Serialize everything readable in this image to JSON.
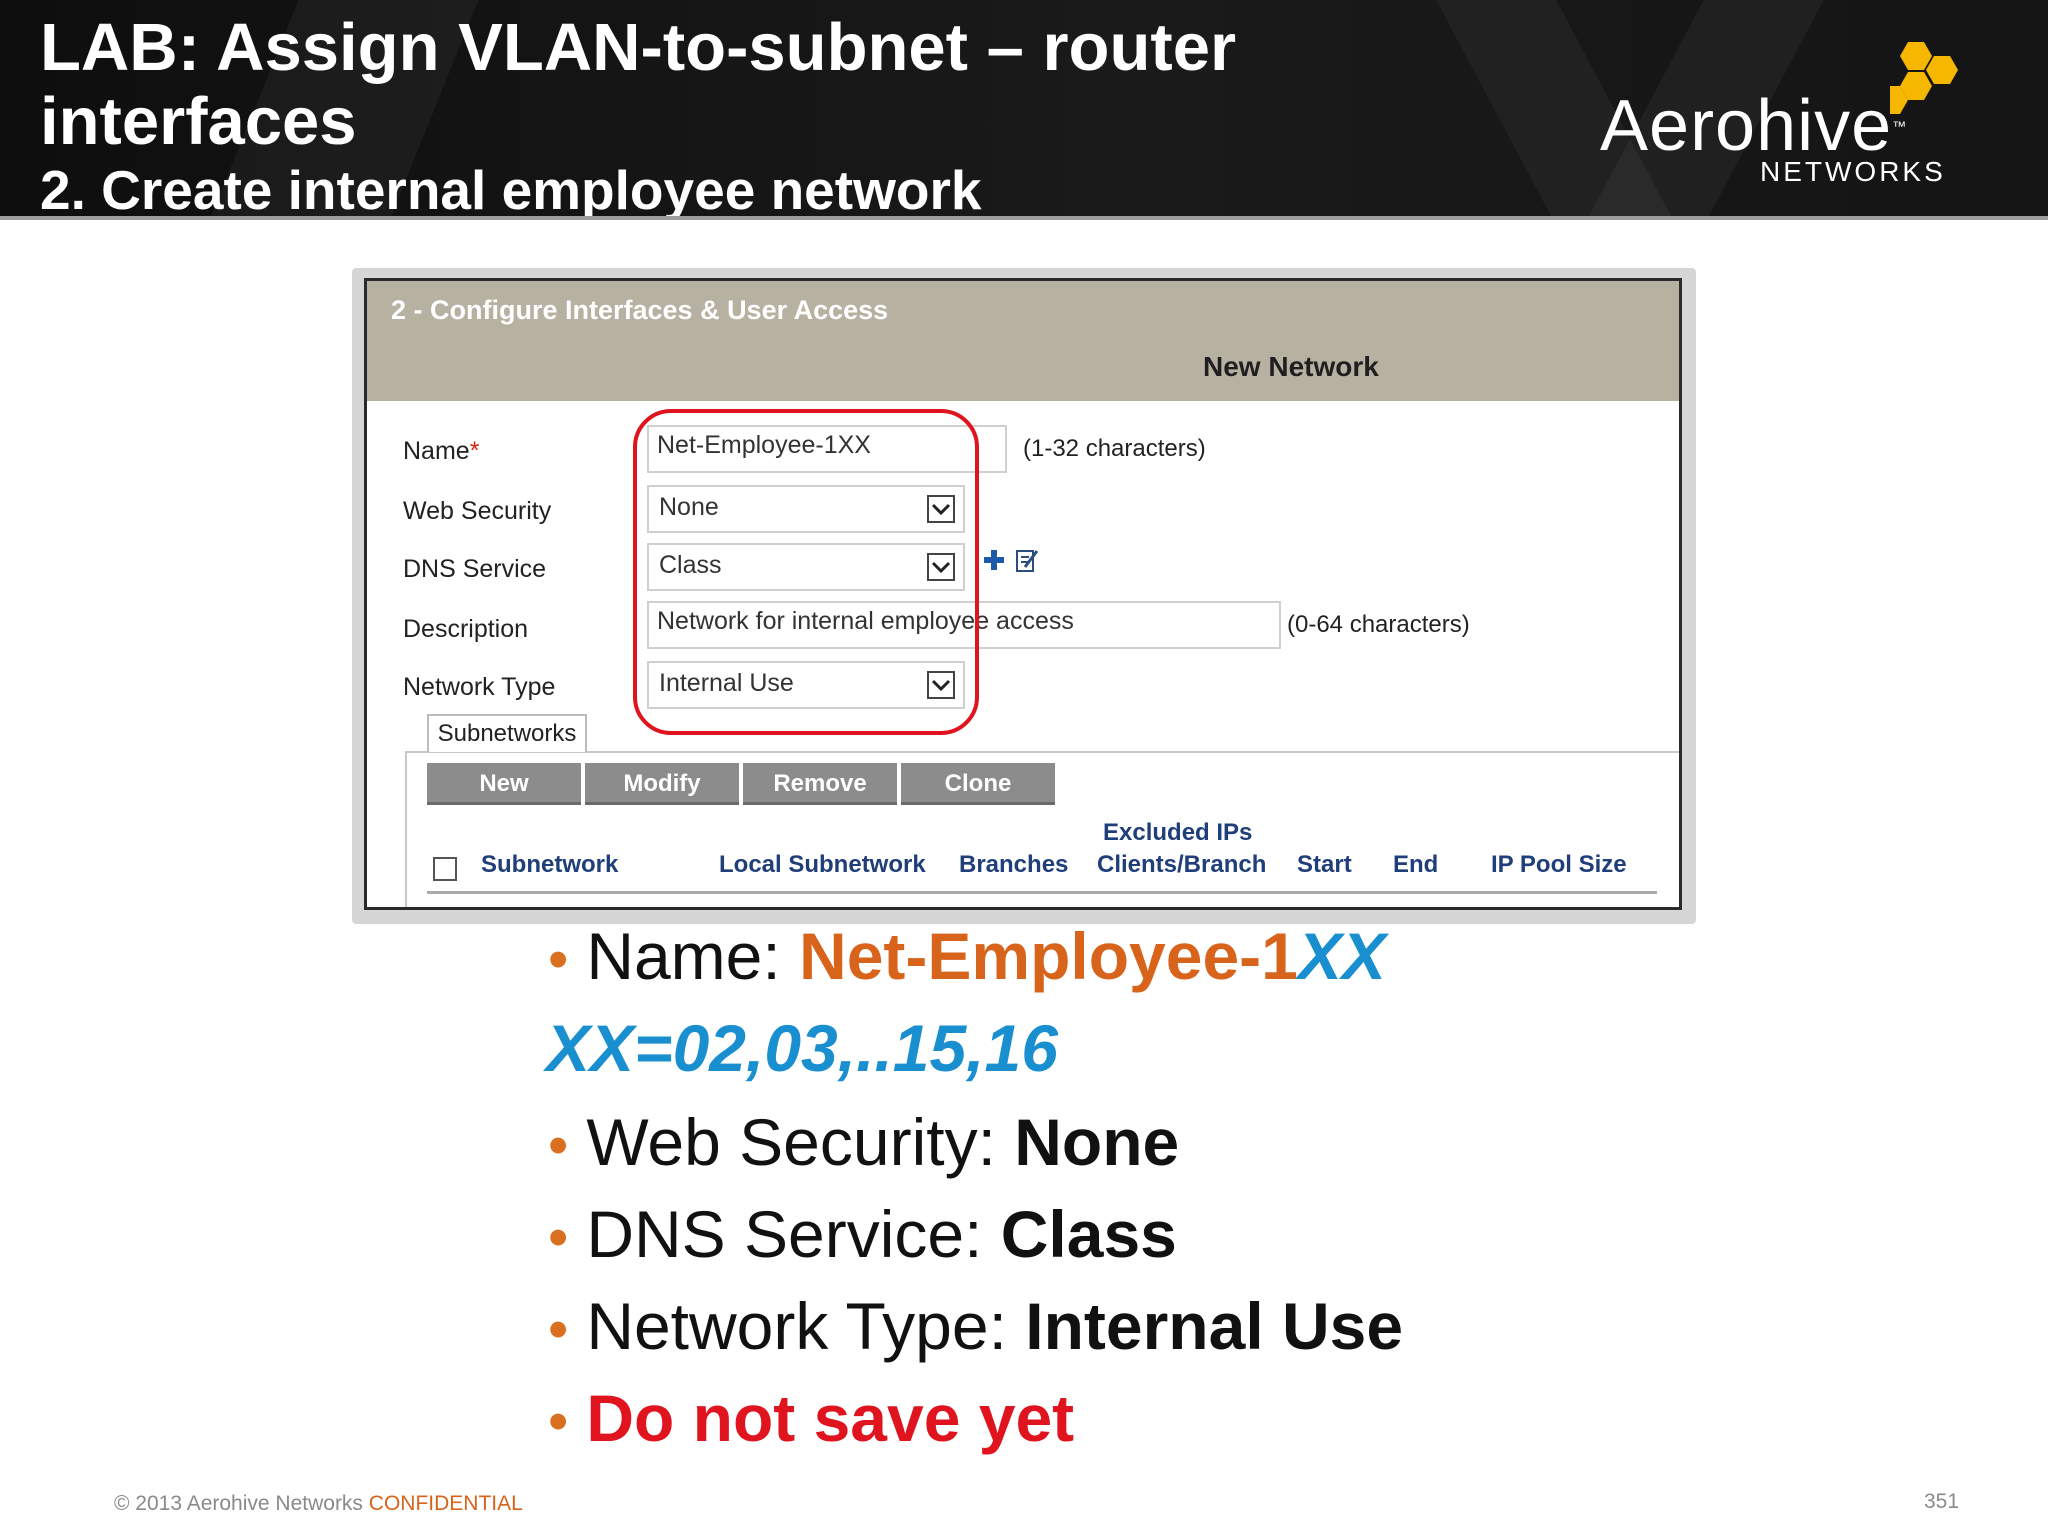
{
  "slide": {
    "title_line1": "LAB: Assign VLAN-to-subnet – router",
    "title_line2": "interfaces",
    "subtitle": "2. Create internal employee network",
    "logo_word": "Aerohive",
    "logo_tm": "™",
    "logo_sub": "NETWORKS"
  },
  "panel": {
    "title": "2 - Configure Interfaces & User Access",
    "subtitle": "New Network",
    "form": {
      "name_label": "Name",
      "required_mark": "*",
      "name_value": "Net-Employee-1XX",
      "name_hint": "(1-32 characters)",
      "web_security_label": "Web Security",
      "web_security_value": "None",
      "dns_service_label": "DNS Service",
      "dns_service_value": "Class",
      "description_label": "Description",
      "description_value": "Network for internal employee access",
      "description_hint": "(0-64 characters)",
      "network_type_label": "Network Type",
      "network_type_value": "Internal Use"
    },
    "subnet_tab": "Subnetworks",
    "buttons": [
      "New",
      "Modify",
      "Remove",
      "Clone"
    ],
    "columns": {
      "subnetwork": "Subnetwork",
      "local_subnetwork": "Local Subnetwork",
      "branches": "Branches",
      "excluded_ips": "Excluded IPs",
      "clients_branch": "Clients/Branch",
      "start": "Start",
      "end": "End",
      "ip_pool_size": "IP Pool Size"
    }
  },
  "bullets": {
    "name_label": "Name: ",
    "name_value_prefix": "Net-Employee-1",
    "name_value_suffix": "XX",
    "xx_note": "XX=02,03,..15,16",
    "web_label": "Web Security: ",
    "web_value": "None",
    "dns_label": "DNS Service: ",
    "dns_value": "Class",
    "type_label": "Network Type: ",
    "type_value": "Internal Use",
    "warning": "Do not save yet",
    "bullet_char": "•"
  },
  "footer": {
    "copyright": "© 2013 Aerohive Networks ",
    "confidential": "CONFIDENTIAL",
    "page_number": "351"
  },
  "colors": {
    "accent_orange": "#d8641c",
    "accent_blue": "#1a8fd0",
    "alert_red": "#e0141e",
    "logo_gold": "#f5b700"
  },
  "icons": {
    "dropdown": "chevron-down-icon",
    "add": "plus-icon",
    "edit": "edit-icon",
    "logo_mark": "hexagon-cluster-icon"
  }
}
